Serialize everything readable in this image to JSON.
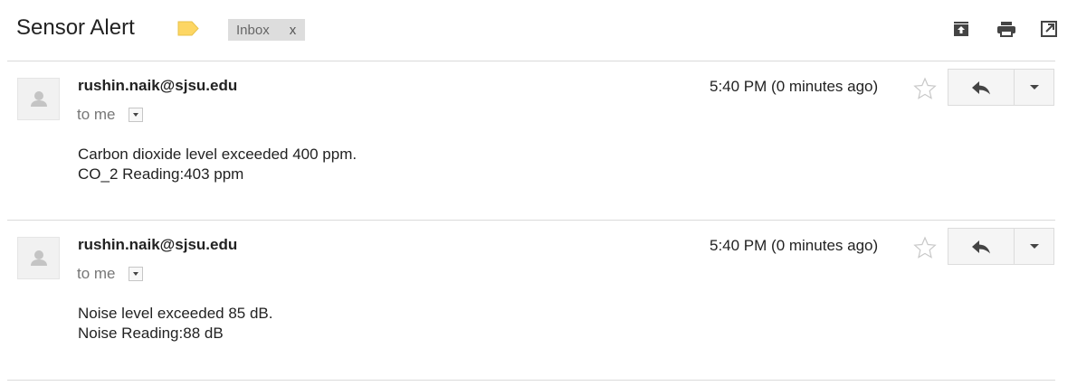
{
  "subject": "Sensor Alert",
  "labels": [
    {
      "name": "Inbox",
      "remove": "x"
    }
  ],
  "header_icons": [
    "archive-icon",
    "print-icon",
    "popout-icon"
  ],
  "messages": [
    {
      "sender": "rushin.naik@sjsu.edu",
      "to": "to me",
      "time": "5:40 PM (0 minutes ago)",
      "body": [
        "Carbon dioxide level exceeded 400 ppm.",
        "CO_2 Reading:403 ppm"
      ]
    },
    {
      "sender": "rushin.naik@sjsu.edu",
      "to": "to me",
      "time": "5:40 PM (0 minutes ago)",
      "body": [
        "Noise level exceeded 85 dB.",
        "Noise Reading:88 dB"
      ]
    }
  ],
  "colors": {
    "label_tag": "#fdd663",
    "chip_bg": "#dddddd",
    "divider": "#dadada"
  }
}
